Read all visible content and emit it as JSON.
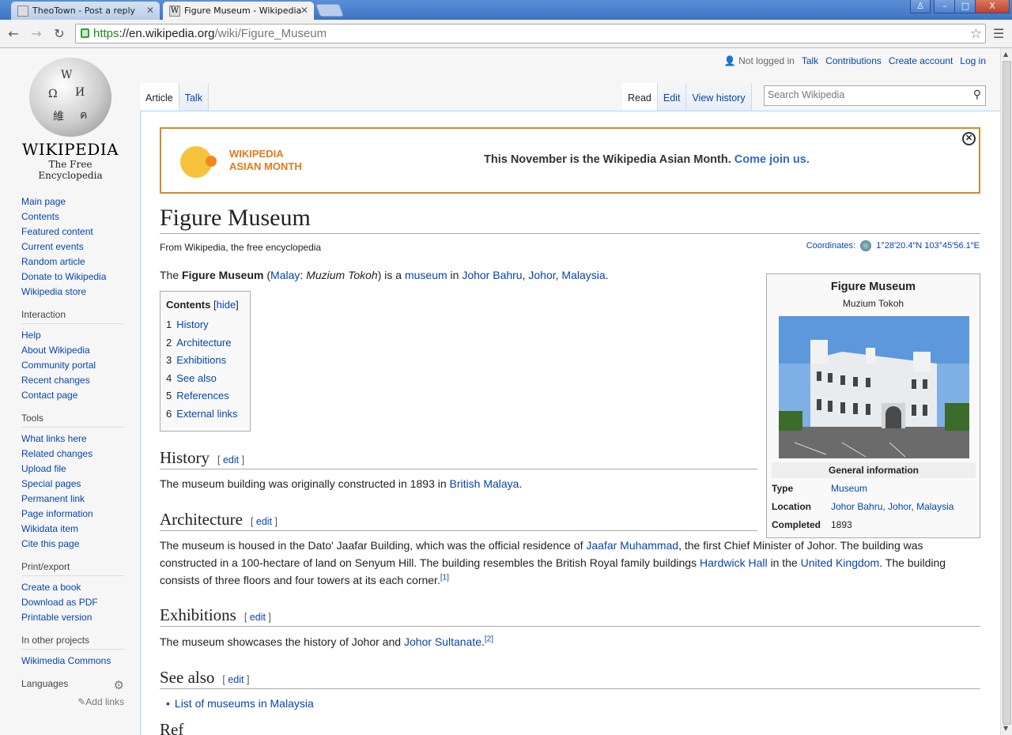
{
  "browser": {
    "tabs": [
      {
        "title": "TheoTown - Post a reply",
        "active": false
      },
      {
        "title": "Figure Museum - Wikipedia",
        "active": true
      }
    ],
    "url_scheme": "https",
    "url_host": "://en.wikipedia.org",
    "url_path": "/wiki/Figure_Museum",
    "window_buttons": [
      "–",
      "□",
      "X"
    ]
  },
  "logo": {
    "wordmark": "WIKIPEDIA",
    "tagline": "The Free Encyclopedia"
  },
  "personal": {
    "not_logged_in": "Not logged in",
    "talk": "Talk",
    "contributions": "Contributions",
    "create_account": "Create account",
    "log_in": "Log in"
  },
  "page_tabs": {
    "left": [
      "Article",
      "Talk"
    ],
    "right": [
      "Read",
      "Edit",
      "View history"
    ]
  },
  "search": {
    "placeholder": "Search Wikipedia"
  },
  "sidebar": {
    "main": [
      "Main page",
      "Contents",
      "Featured content",
      "Current events",
      "Random article",
      "Donate to Wikipedia",
      "Wikipedia store"
    ],
    "interaction_head": "Interaction",
    "interaction": [
      "Help",
      "About Wikipedia",
      "Community portal",
      "Recent changes",
      "Contact page"
    ],
    "tools_head": "Tools",
    "tools": [
      "What links here",
      "Related changes",
      "Upload file",
      "Special pages",
      "Permanent link",
      "Page information",
      "Wikidata item",
      "Cite this page"
    ],
    "print_head": "Print/export",
    "print": [
      "Create a book",
      "Download as PDF",
      "Printable version"
    ],
    "projects_head": "In other projects",
    "projects": [
      "Wikimedia Commons"
    ],
    "languages_head": "Languages",
    "add_links": "Add links"
  },
  "banner": {
    "logo_line1": "WIKIPEDIA",
    "logo_line2": "ASIAN MONTH",
    "message": "This November is the Wikipedia Asian Month.",
    "link": "Come join us."
  },
  "article": {
    "title": "Figure Museum",
    "from": "From Wikipedia, the free encyclopedia",
    "coords_label": "Coordinates:",
    "coords_value": "1°28′20.4″N 103°45′56.1″E",
    "lead": {
      "the": "The ",
      "name": "Figure Museum",
      "open": " (",
      "malay": "Malay",
      "colon": ": ",
      "malay_name": "Muzium Tokoh",
      "is_a": ") is a ",
      "museum": "museum",
      "in": " in ",
      "johor_bahru": "Johor Bahru",
      "comma1": ", ",
      "johor": "Johor",
      "comma2": ", ",
      "malaysia": "Malaysia",
      "end": "."
    },
    "toc": {
      "title": "Contents",
      "hide": "hide",
      "items": [
        {
          "num": "1",
          "label": "History"
        },
        {
          "num": "2",
          "label": "Architecture"
        },
        {
          "num": "3",
          "label": "Exhibitions"
        },
        {
          "num": "4",
          "label": "See also"
        },
        {
          "num": "5",
          "label": "References"
        },
        {
          "num": "6",
          "label": "External links"
        }
      ]
    },
    "edit_label": "edit",
    "history": {
      "heading": "History",
      "text": "The museum building was originally constructed in 1893 in ",
      "link": "British Malaya",
      "end": "."
    },
    "architecture": {
      "heading": "Architecture",
      "t1": "The museum is housed in the Dato' Jaafar Building, which was the official residence of ",
      "l1": "Jaafar Muhammad",
      "t2": ", the first Chief Minister of Johor. The building was constructed in a 100-hectare of land on Senyum Hill. The building resembles the British Royal family buildings ",
      "l2": "Hardwick Hall",
      "t3": " in the ",
      "l3": "United Kingdom",
      "t4": ". The building consists of three floors and four towers at its each corner.",
      "ref": "[1]"
    },
    "exhibitions": {
      "heading": "Exhibitions",
      "text": "The museum showcases the history of Johor and ",
      "link": "Johor Sultanate",
      "end": ".",
      "ref": "[2]"
    },
    "see_also": {
      "heading": "See also",
      "item": "List of museums in Malaysia"
    }
  },
  "infobox": {
    "title": "Figure Museum",
    "subtitle": "Muzium Tokoh",
    "section": "General information",
    "rows": [
      {
        "label": "Type",
        "value": "Museum"
      },
      {
        "label": "Location",
        "v1": "Johor Bahru",
        "v2": "Johor",
        "v3": "Malaysia"
      },
      {
        "label": "Completed",
        "value": "1893"
      }
    ]
  }
}
